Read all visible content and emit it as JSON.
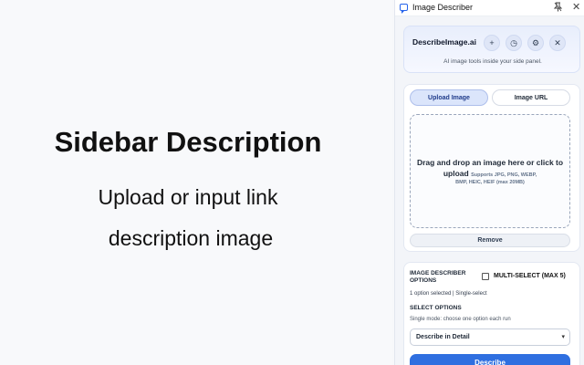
{
  "promo": {
    "title": "Sidebar Description",
    "line1": "Upload or input link",
    "line2": "description image"
  },
  "panel": {
    "title": "Image Describer",
    "pin_icon": "pin-icon",
    "close_glyph": "✕",
    "brand": {
      "name": "DescribeImage.ai",
      "subtitle": "AI image tools inside your side panel.",
      "buttons": [
        {
          "icon": "plus-icon",
          "glyph": "+"
        },
        {
          "icon": "history-icon",
          "glyph": "◷"
        },
        {
          "icon": "settings-icon",
          "glyph": "⚙"
        },
        {
          "icon": "close-icon",
          "glyph": "✕"
        }
      ]
    },
    "upload": {
      "tabs": [
        "Upload Image",
        "Image URL"
      ],
      "active_tab": "Upload Image",
      "drop_main": "Drag and drop an image here or click to upload",
      "drop_formats_inline": "Supports JPG, PNG, WEBP,",
      "drop_formats_line2": "BMP, HEIC, HEIF (max 20MB)",
      "remove_label": "Remove"
    },
    "options": {
      "heading_line1": "IMAGE DESCRIBER",
      "heading_line2": "OPTIONS",
      "multi_select_label": "MULTI-SELECT (MAX 5)",
      "multi_select_checked": false,
      "status": "1 option selected | Single-select",
      "select_heading": "SELECT OPTIONS",
      "select_hint": "Single mode: choose one option each run",
      "selected_value": "Describe in Detail",
      "describe_label": "Describe"
    }
  },
  "colors": {
    "accent": "#2f6fe0",
    "tab_active_bg": "#dbe5fb",
    "brand_card_bg": "#e8eefc"
  }
}
